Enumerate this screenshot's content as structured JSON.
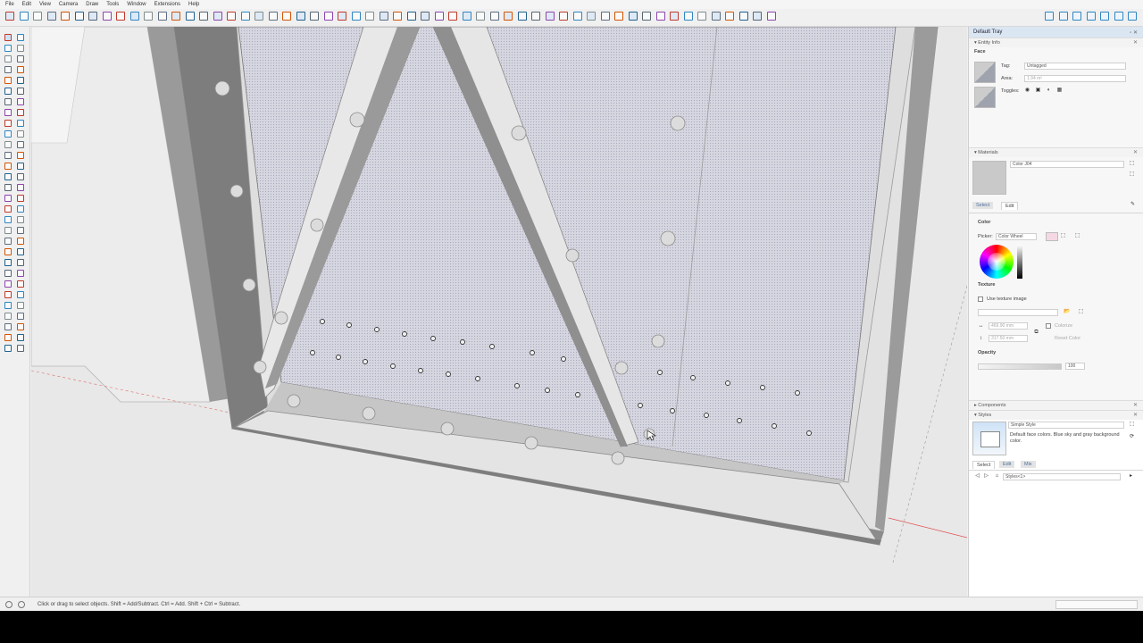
{
  "menu": [
    "File",
    "Edit",
    "View",
    "Camera",
    "Draw",
    "Tools",
    "Window",
    "Extensions",
    "Help"
  ],
  "icons": {
    "toolbar": [
      "select-icon",
      "eraser-icon",
      "paint-icon",
      "line-icon",
      "arc-icon",
      "rectangle-icon",
      "circle-icon",
      "push-pull-icon",
      "move-icon",
      "rotate-icon",
      "scale-icon",
      "offset-icon",
      "tape-measure-icon",
      "text-icon",
      "axes-icon",
      "orbit-icon",
      "pan-icon",
      "zoom-icon",
      "zoom-extents-icon",
      "section-plane-icon"
    ],
    "left_tools": [
      "select-icon",
      "eraser-icon",
      "paint-icon",
      "line-icon",
      "freehand-icon",
      "rectangle-icon",
      "circle-icon",
      "polygon-icon",
      "arc-icon",
      "move-icon",
      "push-pull-icon",
      "rotate-icon",
      "follow-me-icon",
      "scale-icon",
      "offset-icon",
      "tape-icon",
      "dimension-icon",
      "protractor-icon",
      "text-icon",
      "axes-icon",
      "3d-text-icon",
      "orbit-icon",
      "pan-icon",
      "zoom-icon",
      "zoom-window-icon",
      "zoom-extents-icon",
      "walk-icon",
      "look-around-icon",
      "position-camera-icon",
      "section-icon"
    ]
  },
  "tray": {
    "title": "Default Tray",
    "entity_info": {
      "header": "Entity Info",
      "type": "Face",
      "tag_label": "Tag:",
      "tag_value": "Untagged",
      "area_label": "Area:",
      "area_value": "1.94 m²",
      "toggles_label": "Toggles:"
    },
    "materials": {
      "header": "Materials",
      "name": "Color J04",
      "tab_select": "Select",
      "tab_edit": "Edit",
      "color_label": "Color",
      "picker_label": "Picker:",
      "picker_value": "Color Wheel",
      "texture_label": "Texture",
      "use_texture": "Use texture image",
      "width_value": "469.90 mm",
      "height_value": "317.50 mm",
      "colorize": "Colorize",
      "reset_color": "Reset Color",
      "opacity_label": "Opacity",
      "opacity_value": "100"
    },
    "components": {
      "header": "Components"
    },
    "styles": {
      "header": "Styles",
      "name": "Simple Style",
      "description": "Default face colors. Blue sky and gray background color.",
      "tab_select": "Select",
      "tab_edit": "Edit",
      "tab_mix": "Mix",
      "dropdown": "Styles<1>"
    }
  },
  "status": {
    "text": "Click or drag to select objects. Shift = Add/Subtract. Ctrl = Add. Shift + Ctrl = Subtract."
  },
  "colors": {
    "accent": "#3b7fd6",
    "panel_face": "#d4d4dc",
    "frame": "#dcdcdc",
    "frame_shadow": "#8a8a8a"
  }
}
